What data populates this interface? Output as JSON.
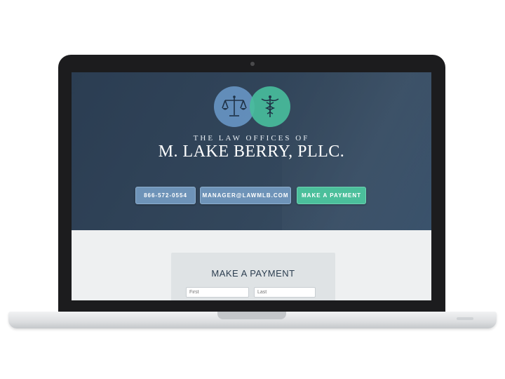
{
  "hero": {
    "tagline": "THE LAW OFFICES OF",
    "firm_name": "M. LAKE BERRY, PLLC.",
    "buttons": {
      "phone_label": "866-572-0554",
      "email_label": "MANAGER@LAWMLB.COM",
      "payment_label": "MAKE A PAYMENT"
    }
  },
  "payment_form": {
    "title": "MAKE A PAYMENT",
    "first_name": {
      "value": "",
      "placeholder": "First"
    },
    "last_name": {
      "value": "",
      "placeholder": "Last"
    }
  },
  "icons": {
    "left_logo": "scales-of-justice-icon",
    "right_logo": "caduceus-icon"
  },
  "colors": {
    "hero_bg": "#2e4157",
    "accent_blue": "#6e93b8",
    "accent_teal": "#4bbf9b",
    "page_bg": "#eef0f1"
  }
}
